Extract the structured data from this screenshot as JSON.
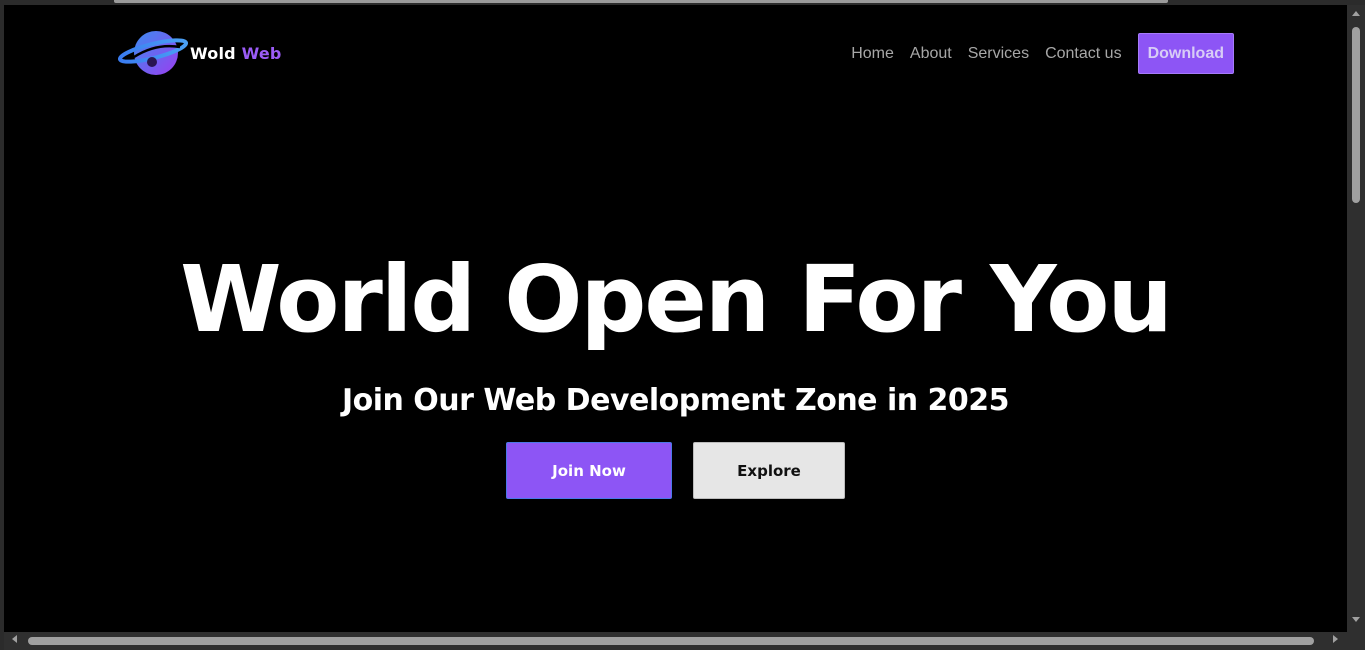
{
  "brand": {
    "name_primary": "Wold",
    "name_accent": "Web",
    "logo_icon": "planet-icon",
    "accent_color": "#9b5cf6"
  },
  "nav": {
    "items": [
      {
        "label": "Home"
      },
      {
        "label": "About"
      },
      {
        "label": "Services"
      },
      {
        "label": "Contact us"
      }
    ],
    "download_label": "Download"
  },
  "hero": {
    "title": "World Open For You",
    "subtitle": "Join Our Web Development Zone in 2025",
    "primary_button": "Join Now",
    "secondary_button": "Explore"
  },
  "colors": {
    "background": "#000000",
    "primary": "#8d55f5",
    "secondary_button_bg": "#e6e6e6"
  }
}
